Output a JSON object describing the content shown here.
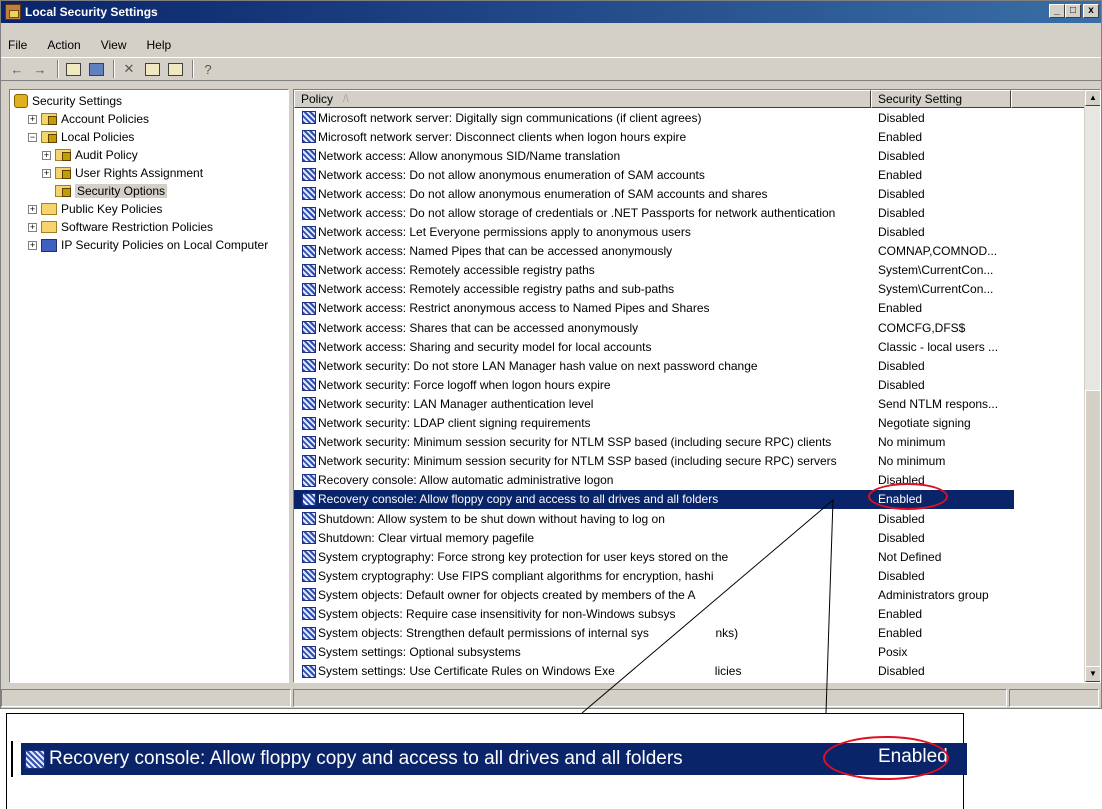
{
  "window": {
    "title": "Local Security Settings",
    "min_label": "_",
    "max_label": "□",
    "close_label": "x"
  },
  "menu": [
    "File",
    "Action",
    "View",
    "Help"
  ],
  "toolbar_icons": [
    "back-arrow-icon",
    "forward-arrow-icon",
    "up-folder-icon",
    "show-hide-tree-icon",
    "delete-icon",
    "properties-icon",
    "export-list-icon",
    "help-icon"
  ],
  "tree": [
    {
      "label": "Security Settings",
      "level": 0,
      "expander": "",
      "icon": "shield"
    },
    {
      "label": "Account Policies",
      "level": 1,
      "expander": "+",
      "icon": "folder-lock"
    },
    {
      "label": "Local Policies",
      "level": 1,
      "expander": "−",
      "icon": "folder-lock"
    },
    {
      "label": "Audit Policy",
      "level": 2,
      "expander": "+",
      "icon": "folder-lock"
    },
    {
      "label": "User Rights Assignment",
      "level": 2,
      "expander": "+",
      "icon": "folder-lock"
    },
    {
      "label": "Security Options",
      "level": 2,
      "expander": "",
      "icon": "folder-lock",
      "selected": true
    },
    {
      "label": "Public Key Policies",
      "level": 1,
      "expander": "+",
      "icon": "folder"
    },
    {
      "label": "Software Restriction Policies",
      "level": 1,
      "expander": "+",
      "icon": "folder"
    },
    {
      "label": "IP Security Policies on Local Computer",
      "level": 1,
      "expander": "+",
      "icon": "netcomp"
    }
  ],
  "columns": {
    "policy": "Policy",
    "sort_indicator": "/\\",
    "setting": "Security Setting"
  },
  "rows": [
    {
      "policy": "Microsoft network server: Digitally sign communications (if client agrees)",
      "setting": "Disabled"
    },
    {
      "policy": "Microsoft network server: Disconnect clients when logon hours expire",
      "setting": "Enabled"
    },
    {
      "policy": "Network access: Allow anonymous SID/Name translation",
      "setting": "Disabled"
    },
    {
      "policy": "Network access: Do not allow anonymous enumeration of SAM accounts",
      "setting": "Enabled"
    },
    {
      "policy": "Network access: Do not allow anonymous enumeration of SAM accounts and shares",
      "setting": "Disabled"
    },
    {
      "policy": "Network access: Do not allow storage of credentials or .NET Passports for network authentication",
      "setting": "Disabled"
    },
    {
      "policy": "Network access: Let Everyone permissions apply to anonymous users",
      "setting": "Disabled"
    },
    {
      "policy": "Network access: Named Pipes that can be accessed anonymously",
      "setting": "COMNAP,COMNOD..."
    },
    {
      "policy": "Network access: Remotely accessible registry paths",
      "setting": "System\\CurrentCon..."
    },
    {
      "policy": "Network access: Remotely accessible registry paths and sub-paths",
      "setting": "System\\CurrentCon..."
    },
    {
      "policy": "Network access: Restrict anonymous access to Named Pipes and Shares",
      "setting": "Enabled"
    },
    {
      "policy": "Network access: Shares that can be accessed anonymously",
      "setting": "COMCFG,DFS$"
    },
    {
      "policy": "Network access: Sharing and security model for local accounts",
      "setting": "Classic - local users ..."
    },
    {
      "policy": "Network security: Do not store LAN Manager hash value on next password change",
      "setting": "Disabled"
    },
    {
      "policy": "Network security: Force logoff when logon hours expire",
      "setting": "Disabled"
    },
    {
      "policy": "Network security: LAN Manager authentication level",
      "setting": "Send NTLM respons..."
    },
    {
      "policy": "Network security: LDAP client signing requirements",
      "setting": "Negotiate signing"
    },
    {
      "policy": "Network security: Minimum session security for NTLM SSP based (including secure RPC) clients",
      "setting": "No minimum"
    },
    {
      "policy": "Network security: Minimum session security for NTLM SSP based (including secure RPC) servers",
      "setting": "No minimum"
    },
    {
      "policy": "Recovery console: Allow automatic administrative logon",
      "setting": "Disabled"
    },
    {
      "policy": "Recovery console: Allow floppy copy and access to all drives and all folders",
      "setting": "Enabled",
      "selected": true
    },
    {
      "policy": "Shutdown: Allow system to be shut down without having to log on",
      "setting": "Disabled"
    },
    {
      "policy": "Shutdown: Clear virtual memory pagefile",
      "setting": "Disabled"
    },
    {
      "policy": "System cryptography: Force strong key protection for user keys stored on the",
      "setting": "Not Defined"
    },
    {
      "policy": "System cryptography: Use FIPS compliant algorithms for encryption, hashi",
      "setting": "Disabled"
    },
    {
      "policy": "System objects: Default owner for objects created by members of the A",
      "setting": "Administrators group"
    },
    {
      "policy": "System objects: Require case insensitivity for non-Windows subsys",
      "setting": "Enabled"
    },
    {
      "policy": "System objects: Strengthen default permissions of internal sys                    nks)",
      "setting": "Enabled"
    },
    {
      "policy": "System settings: Optional subsystems",
      "setting": "Posix"
    },
    {
      "policy": "System settings: Use Certificate Rules on Windows Exe                              licies",
      "setting": "Disabled"
    }
  ],
  "scroll_arrows": {
    "up": "▲",
    "down": "▼"
  },
  "callout": {
    "policy": "Recovery console: Allow floppy copy and access to all drives and all folders",
    "setting": "Enabled"
  },
  "colors": {
    "title_start": "#0a246a",
    "selection": "#0a246a",
    "highlight_ellipse": "#e01020",
    "chrome": "#d4d0c8"
  }
}
